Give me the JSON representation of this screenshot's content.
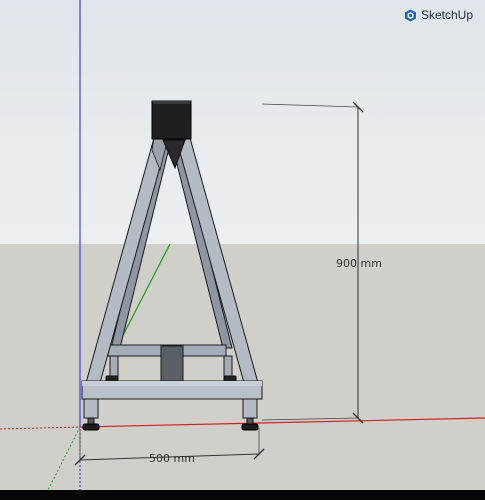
{
  "app": {
    "brand_name": "SketchUp",
    "brand_icon": "sketchup-logo-icon",
    "brand_color": "#1565c0"
  },
  "viewport": {
    "sky_color": "#e6eaee",
    "ground_color": "#d0cfca",
    "axis_colors": {
      "red": "#d42020",
      "green": "#1e9e1e",
      "blue": "#2222cc"
    }
  },
  "dimensions": {
    "height_label": "900 mm",
    "width_label": "500 mm"
  },
  "model": {
    "name": "a-frame-stand",
    "frame_color": "#aab2bd",
    "cap_color": "#222222"
  }
}
